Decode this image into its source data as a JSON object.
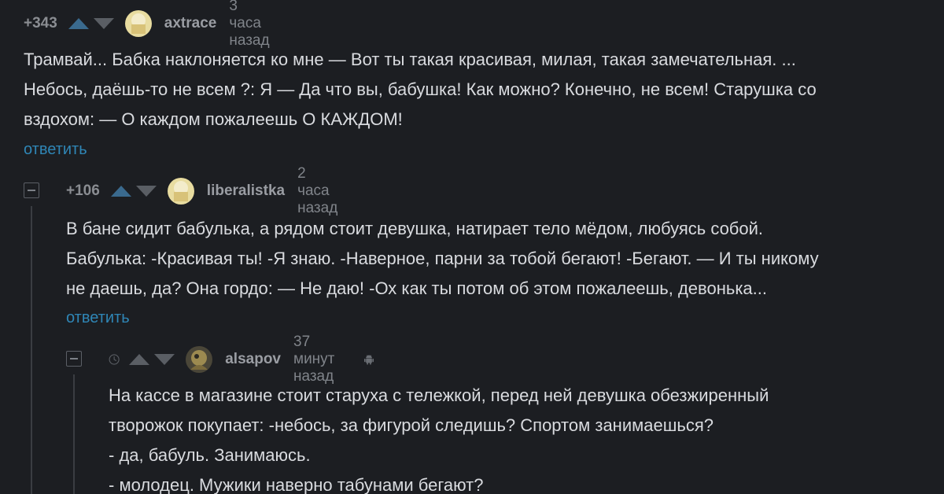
{
  "comments": [
    {
      "rating": "+343",
      "username": "axtrace",
      "time": "3 часа назад",
      "lines": [
        "Трамвай... Бабка наклоняется ко мне — Вот ты такая красивая, милая, такая замечательная. ...",
        "Небось, даёшь-то не всем ?: Я — Да что вы, бабушка! Как можно? Конечно, не всем! Старушка со",
        "вздохом: — О каждом пожалеешь О КАЖДОМ!"
      ],
      "reply_label": "ответить"
    },
    {
      "rating": "+106",
      "username": "liberalistka",
      "time": "2 часа назад",
      "lines": [
        "В бане сидит бабулька, а рядом стоит девушка, натирает тело мёдом, любуясь собой.",
        "Бабулька: -Красивая ты! -Я знаю. -Наверное, парни за тобой бегают! -Бегают. — И ты никому",
        "не даешь, да? Она гордо: — Не даю! -Ох как ты потом об этом пожалеешь, девонька..."
      ],
      "reply_label": "ответить"
    },
    {
      "username": "alsapov",
      "time": "37 минут назад",
      "lines": [
        "На кассе в магазине стоит старуха с тележкой, перед ней девушка обезжиренный",
        "творожок покупает: -небось, за фигурой следишь? Спортом занимаешься?",
        "- да, бабуль. Занимаюсь.",
        "- молодец. Мужики наверно табунами бегают?"
      ]
    }
  ],
  "colors": {
    "background": "#1c1e22",
    "vote_up": "#3a6a8e",
    "vote_up_active": "#2f86b6",
    "vote_down": "#5a5e64",
    "link": "#2f86b6"
  },
  "icons": [
    "upvote-icon",
    "downvote-icon",
    "clock-icon",
    "android-icon",
    "collapse-icon"
  ]
}
